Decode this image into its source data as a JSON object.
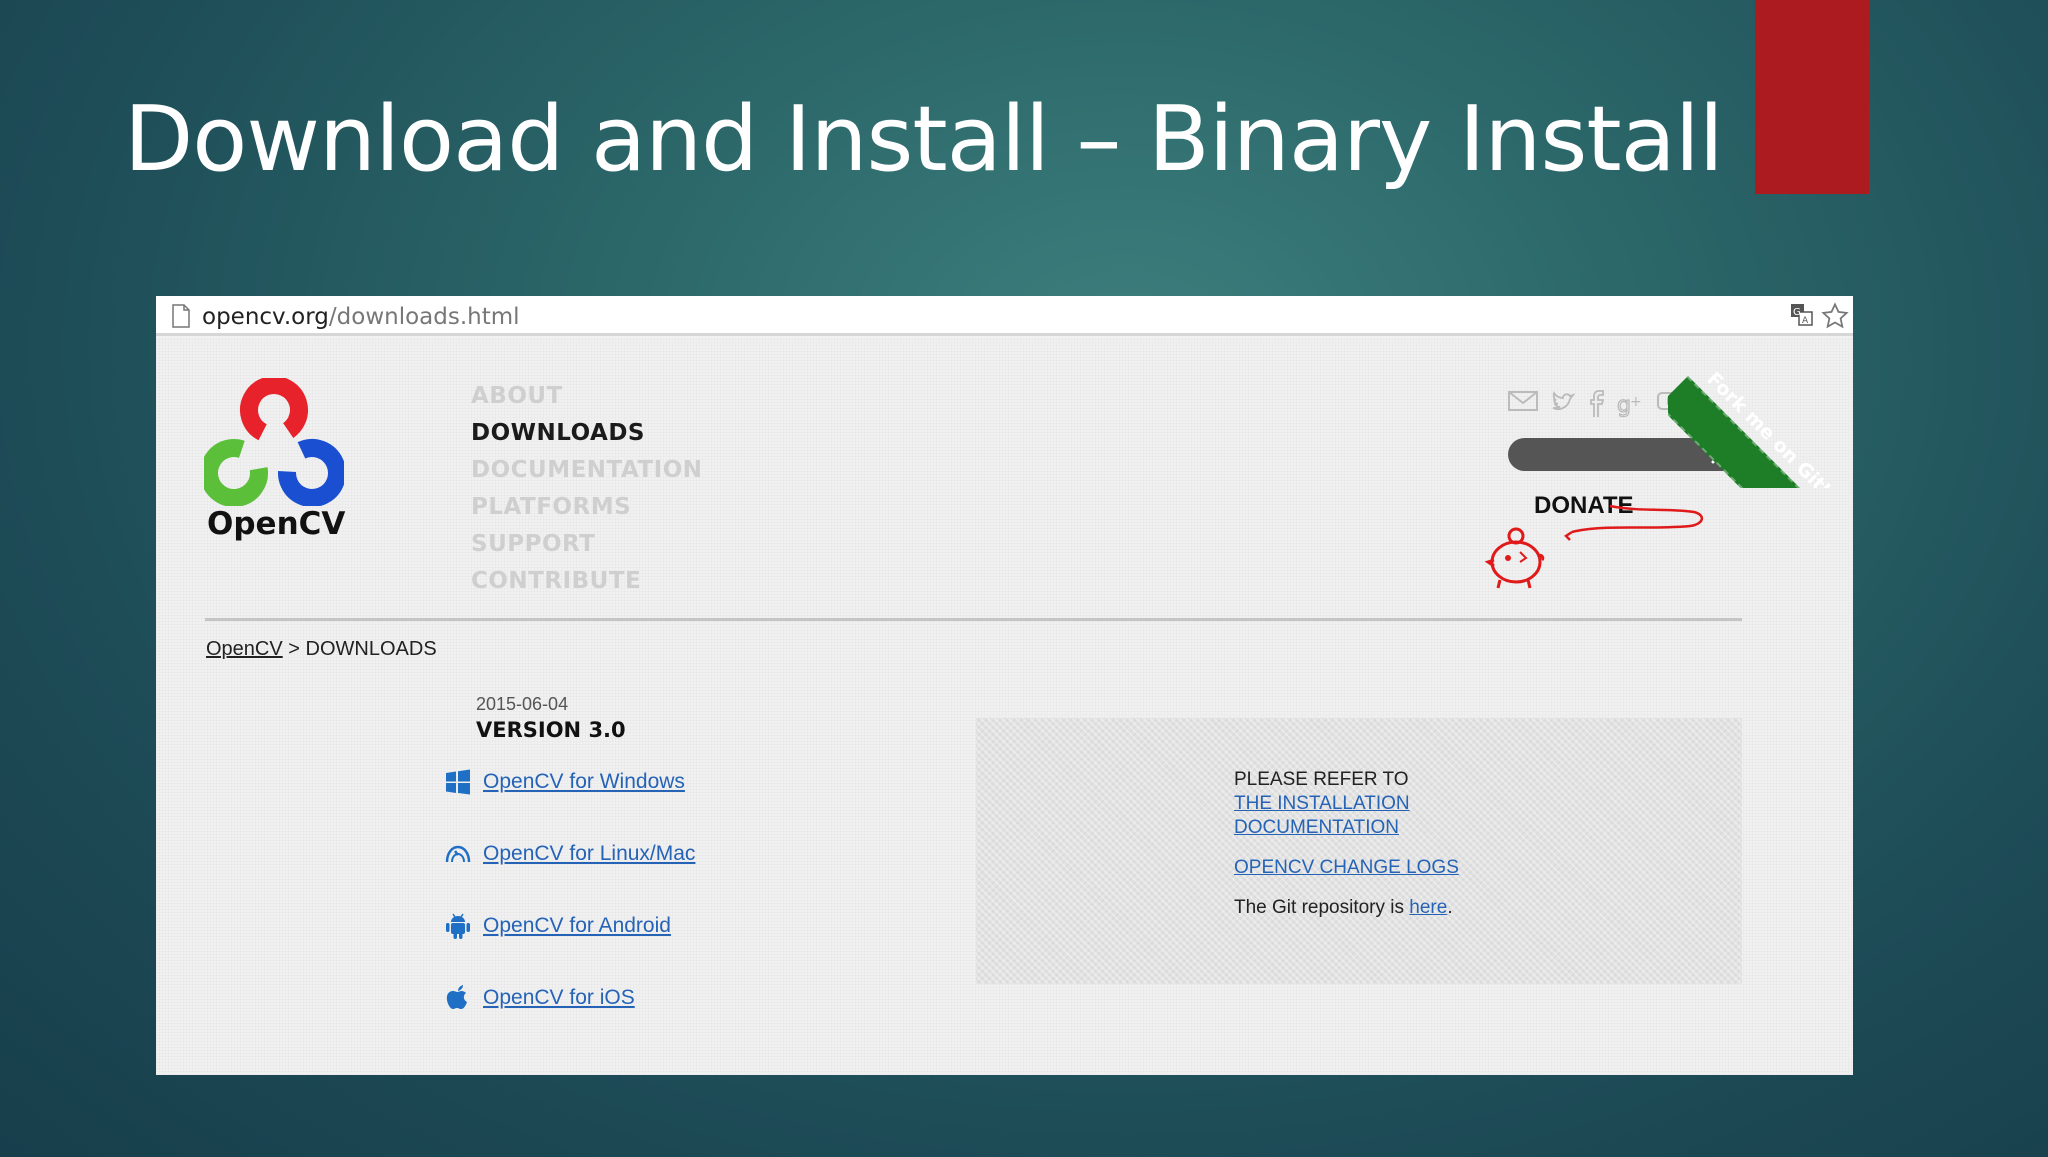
{
  "slide": {
    "title": "Download and Install – Binary Install"
  },
  "browser": {
    "url_domain": "opencv.org",
    "url_path": "/downloads.html"
  },
  "site": {
    "logo_text": "OpenCV",
    "nav": [
      "ABOUT",
      "DOWNLOADS",
      "DOCUMENTATION",
      "PLATFORMS",
      "SUPPORT",
      "CONTRIBUTE"
    ],
    "active_nav": "DOWNLOADS",
    "donate_label": "DONATE",
    "ribbon_text": "Fork me on GitHub",
    "social_icons": [
      "mail-icon",
      "twitter-icon",
      "facebook-icon",
      "google-plus-icon",
      "youtube-icon"
    ]
  },
  "breadcrumb": {
    "home": "OpenCV",
    "separator": ">",
    "current": "DOWNLOADS"
  },
  "release": {
    "date": "2015-06-04",
    "version": "VERSION 3.0",
    "downloads": [
      {
        "label": "OpenCV for Windows",
        "icon": "windows-icon"
      },
      {
        "label": "OpenCV for Linux/Mac",
        "icon": "linux-mac-icon"
      },
      {
        "label": "OpenCV for Android",
        "icon": "android-icon"
      },
      {
        "label": "OpenCV for iOS",
        "icon": "apple-icon"
      }
    ]
  },
  "info": {
    "refer_text": "PLEASE REFER TO",
    "install_doc_line1": "THE INSTALLATION",
    "install_doc_line2": "DOCUMENTATION",
    "changelog_link": "OPENCV CHANGE LOGS",
    "git_text": "The Git repository is",
    "git_link": "here",
    "git_suffix": "."
  },
  "colors": {
    "accent_red": "#ac1b1f",
    "link_blue": "#2563b7",
    "ribbon_green": "#1e7e27"
  }
}
